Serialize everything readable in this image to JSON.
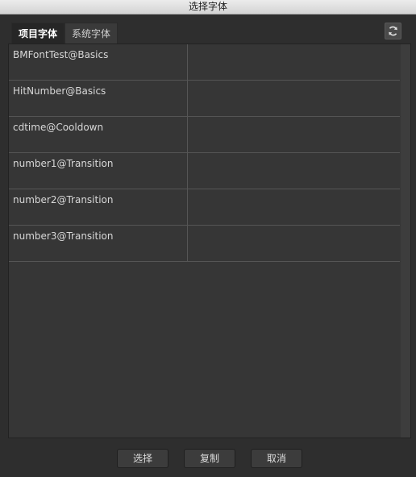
{
  "window": {
    "title": "选择字体"
  },
  "tabs": [
    {
      "label": "项目字体",
      "active": true
    },
    {
      "label": "系统字体",
      "active": false
    }
  ],
  "toolbar": {
    "refresh_icon": "refresh-icon"
  },
  "fonts": [
    {
      "name": "BMFontTest@Basics"
    },
    {
      "name": "HitNumber@Basics"
    },
    {
      "name": "cdtime@Cooldown"
    },
    {
      "name": "number1@Transition"
    },
    {
      "name": "number2@Transition"
    },
    {
      "name": "number3@Transition"
    }
  ],
  "buttons": {
    "select": "选择",
    "copy": "复制",
    "cancel": "取消"
  },
  "colors": {
    "background": "#2e2e2e",
    "panel": "#363636",
    "text": "#d6d6d6"
  }
}
